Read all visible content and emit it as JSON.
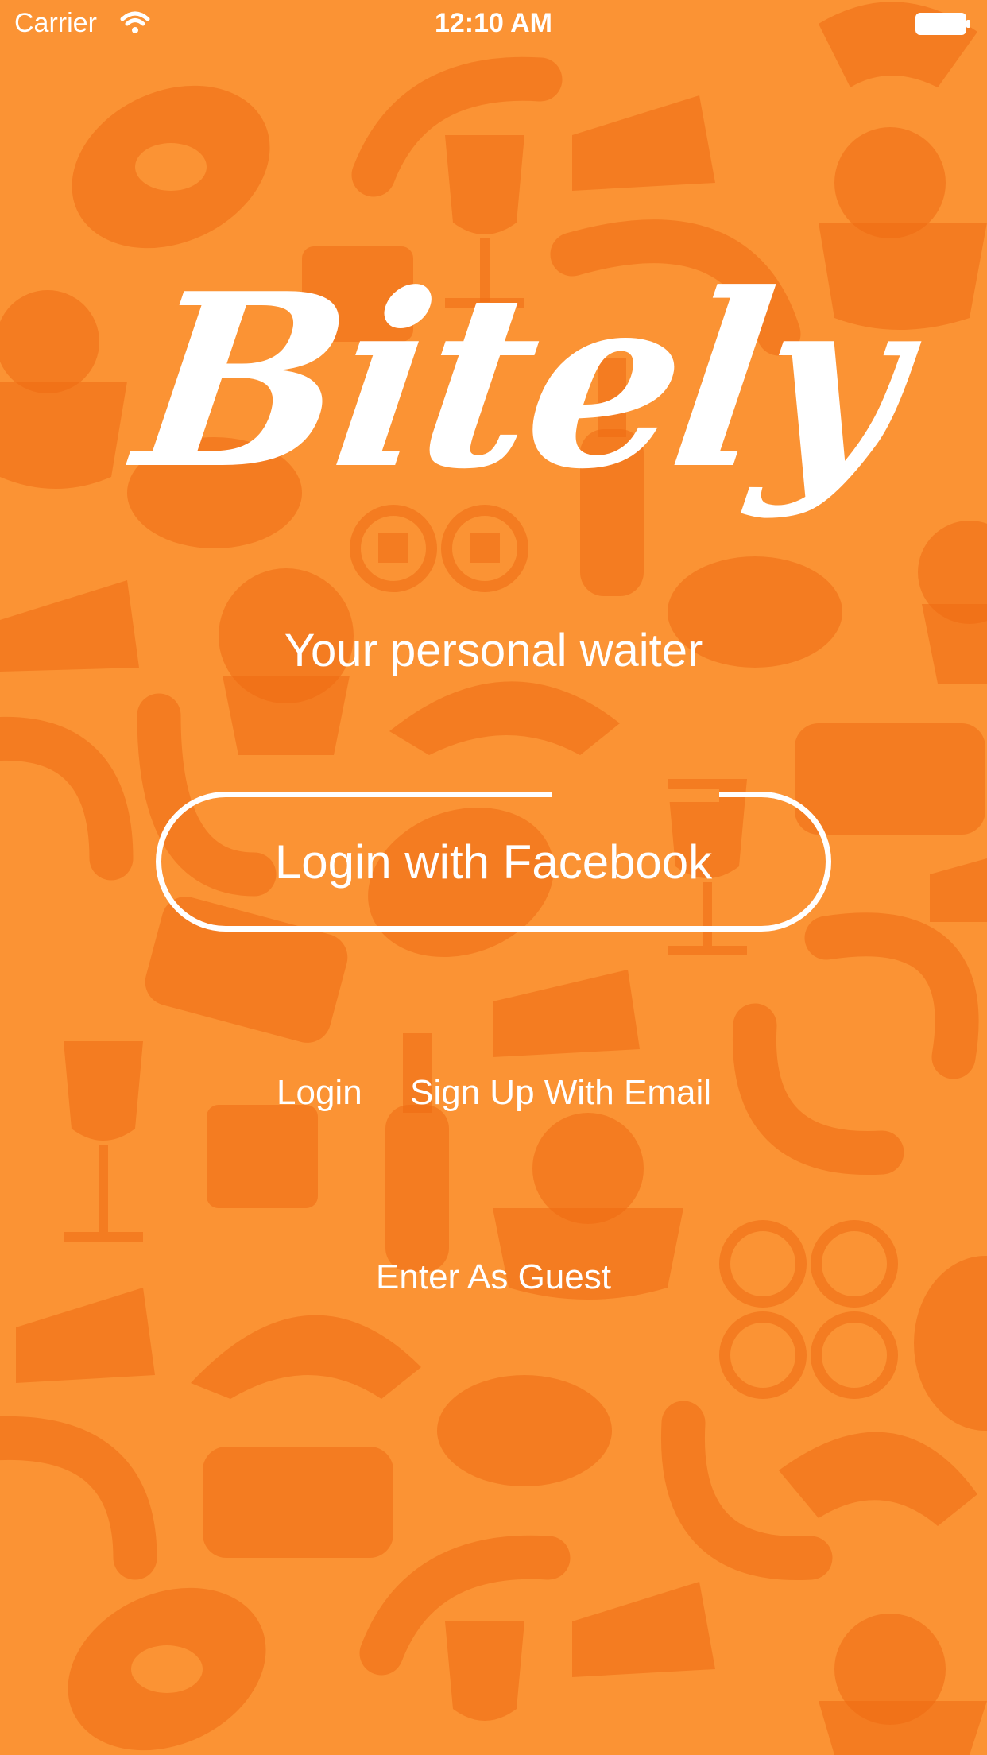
{
  "status_bar": {
    "carrier": "Carrier",
    "time": "12:10 AM",
    "wifi_icon": "wifi-icon",
    "battery_icon": "battery-icon"
  },
  "app": {
    "logo_text": "Bitely",
    "tagline": "Your personal waiter"
  },
  "actions": {
    "facebook_label": "Login with Facebook",
    "login_label": "Login",
    "signup_label": "Sign Up With Email",
    "guest_label": "Enter As Guest"
  },
  "colors": {
    "background": "#fb9334",
    "pattern": "#ef6a12",
    "text": "#ffffff"
  },
  "background_icons": [
    "steak-icon",
    "sausage-icon",
    "wine-glass-icon",
    "cheese-icon",
    "salad-bowl-icon",
    "shrimp-icon",
    "sushi-icon",
    "beer-bottle-icon",
    "roast-chicken-icon",
    "cupcake-icon",
    "croissant-icon",
    "coffee-cup-icon"
  ]
}
